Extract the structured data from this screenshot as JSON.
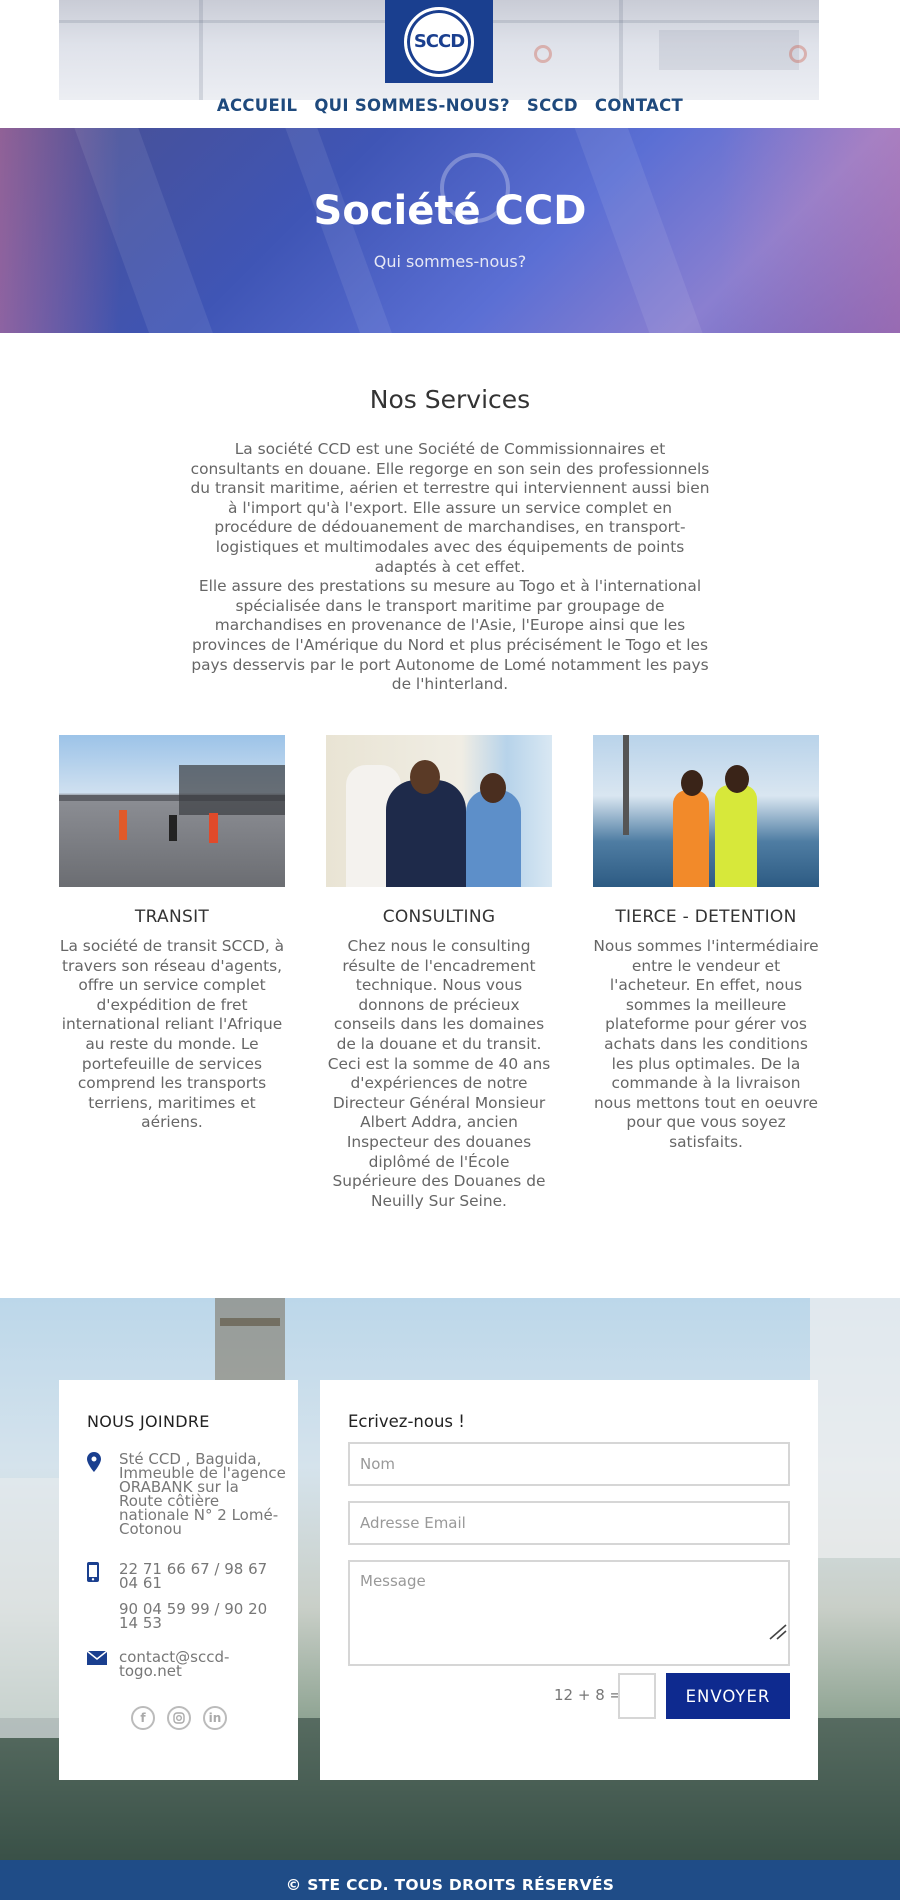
{
  "logo": {
    "text": "SCCD"
  },
  "nav": {
    "items": [
      "ACCUEIL",
      "QUI SOMMES-NOUS?",
      "SCCD",
      "CONTACT"
    ]
  },
  "hero": {
    "title": "Société CCD",
    "subtitle": "Qui sommes-nous?"
  },
  "services": {
    "title": "Nos Services",
    "intro_p1": "La société CCD est une Société de Commissionnaires et consultants en douane. Elle regorge en son sein des professionnels du transit maritime, aérien et terrestre qui interviennent aussi bien à l'import qu'à l'export. Elle assure un service complet en procédure de dédouanement de marchandises, en transport-logistiques et multimodales avec des équipements de points adaptés à cet effet.",
    "intro_p2": "Elle assure des prestations su mesure au Togo et à l'international spécialisée dans le transport maritime par groupage de marchandises en provenance de l'Asie, l'Europe ainsi que les provinces de l'Amérique du Nord et plus précisément le Togo et les pays desservis par le port Autonome de Lomé notamment les pays de l'hinterland.",
    "cards": [
      {
        "title": "TRANSIT",
        "text": "La société de transit SCCD, à travers son réseau d'agents, offre un service complet d'expédition de fret international reliant l'Afrique au reste du monde. Le portefeuille de services comprend les transports terriens, maritimes et aériens."
      },
      {
        "title": "CONSULTING",
        "text": "Chez nous le consulting résulte de l'encadrement technique. Nous vous donnons de précieux conseils dans les domaines de la douane et du transit. Ceci est la somme de 40 ans d'expériences de notre Directeur Général Monsieur Albert Addra, ancien Inspecteur des douanes diplômé de l'École Supérieure des Douanes de Neuilly Sur Seine."
      },
      {
        "title": "TIERCE - DETENTION",
        "text": "Nous sommes l'intermédiaire entre le vendeur et l'acheteur. En effet, nous sommes la meilleure plateforme pour gérer vos achats dans les conditions les plus optimales. De la commande à la livraison nous mettons tout en oeuvre pour que vous soyez satisfaits."
      }
    ]
  },
  "contact": {
    "title": "NOUS JOINDRE",
    "address": "Sté CCD , Baguida, Immeuble de l'agence ORABANK sur la Route côtière nationale N° 2 Lomé-Cotonou",
    "phone1": "22 71 66 67 / 98 67 04 61",
    "phone2": "90 04 59 99 / 90 20 14 53",
    "email": "contact@sccd-togo.net",
    "icons": {
      "address": "map-pin-icon",
      "phone": "mobile-phone-icon",
      "email": "envelope-icon"
    },
    "socials": [
      "facebook-icon",
      "instagram-icon",
      "linkedin-icon"
    ]
  },
  "form": {
    "title": "Ecrivez-nous !",
    "name_placeholder": "Nom",
    "email_placeholder": "Adresse Email",
    "message_placeholder": "Message",
    "captcha": "12 + 8 =",
    "submit": "ENVOYER"
  },
  "footer": {
    "text": "© STE CCD. TOUS DROITS RÉSERVÉS"
  },
  "colors": {
    "brand_blue": "#1a3f8f",
    "nav_blue": "#1f4a7d",
    "button_blue": "#0e2a8f",
    "footer_blue": "#1f4c87"
  }
}
